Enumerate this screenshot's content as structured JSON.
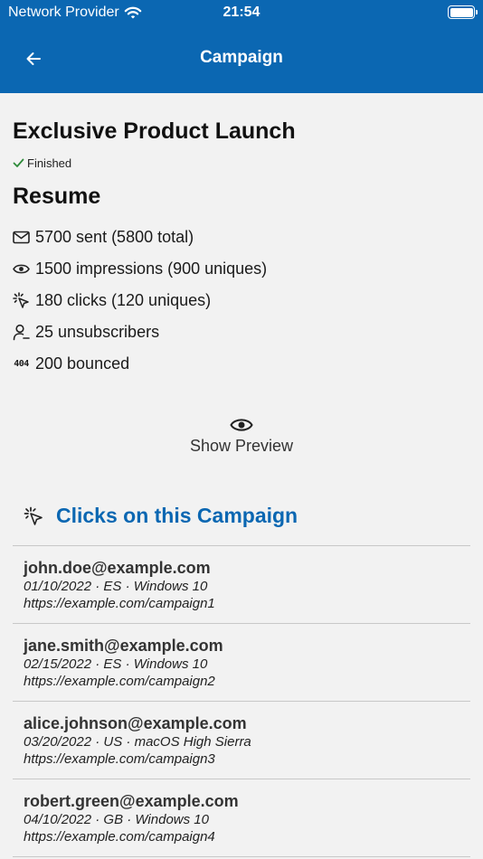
{
  "status_bar": {
    "carrier": "Network Provider",
    "time": "21:54"
  },
  "header": {
    "title": "Campaign"
  },
  "campaign": {
    "name": "Exclusive Product Launch",
    "status": "Finished"
  },
  "resume": {
    "title": "Resume",
    "stats": [
      {
        "icon": "mail-icon",
        "text": "5700 sent (5800 total)"
      },
      {
        "icon": "eye-icon",
        "text": "1500 impressions (900 uniques)"
      },
      {
        "icon": "click-icon",
        "text": "180 clicks (120 uniques)"
      },
      {
        "icon": "user-minus-icon",
        "text": "25 unsubscribers"
      },
      {
        "icon": "error-404-icon",
        "text": "200 bounced",
        "icon_text": "404"
      }
    ]
  },
  "preview": {
    "label": "Show Preview"
  },
  "clicks": {
    "title": "Clicks on this Campaign",
    "items": [
      {
        "email": "john.doe@example.com",
        "meta": "01/10/2022 · ES · Windows 10",
        "url": "https://example.com/campaign1"
      },
      {
        "email": "jane.smith@example.com",
        "meta": "02/15/2022 · ES · Windows 10",
        "url": "https://example.com/campaign2"
      },
      {
        "email": "alice.johnson@example.com",
        "meta": "03/20/2022 · US · macOS High Sierra",
        "url": "https://example.com/campaign3"
      },
      {
        "email": "robert.green@example.com",
        "meta": "04/10/2022 · GB · Windows 10",
        "url": "https://example.com/campaign4"
      }
    ]
  },
  "colors": {
    "brand": "#0b67b2",
    "background": "#f2f2f2",
    "success": "#2e8b3a"
  }
}
